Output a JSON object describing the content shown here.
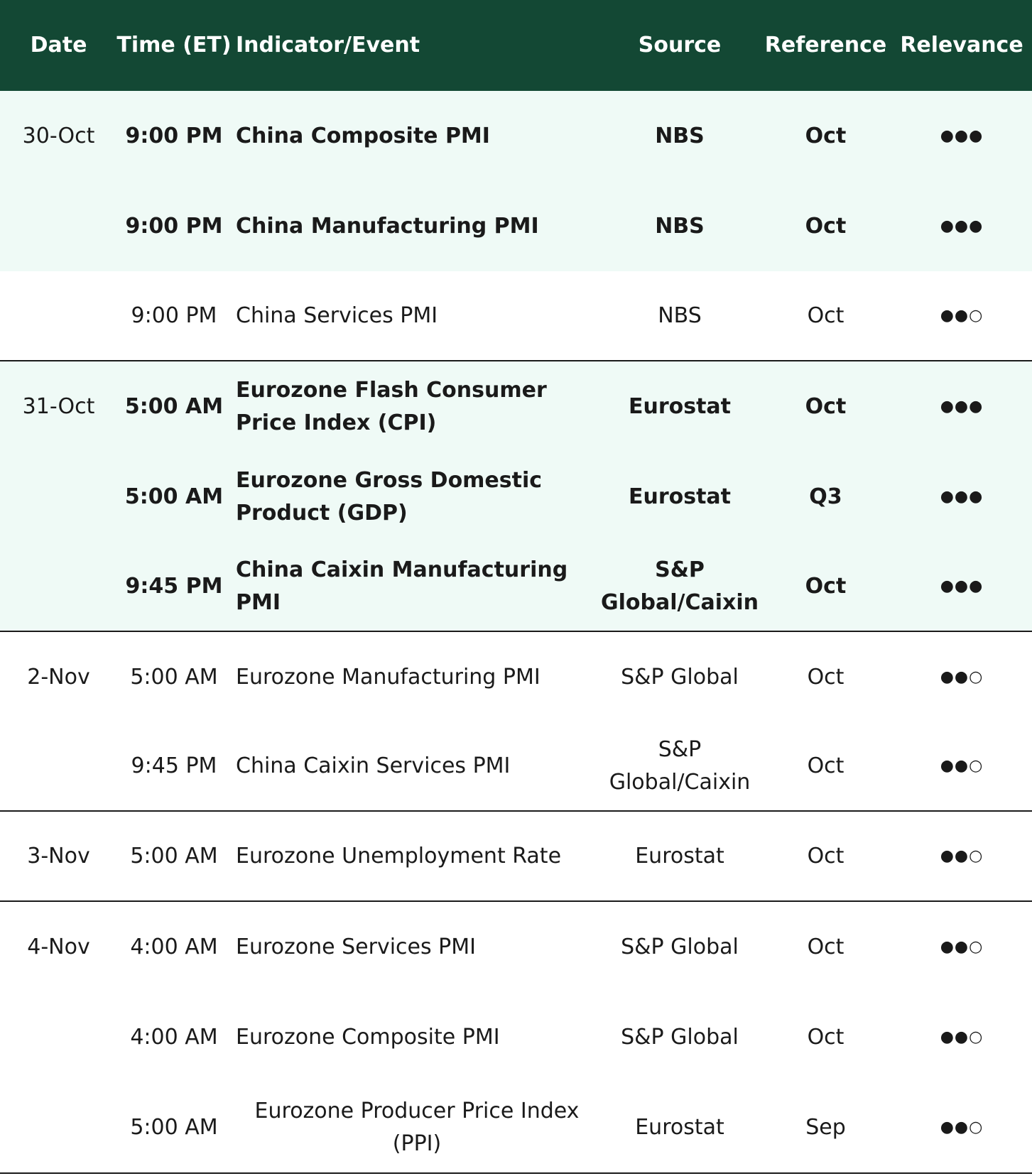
{
  "header": {
    "date": "Date",
    "time": "Time (ET)",
    "indicator": "Indicator/Event",
    "source": "Source",
    "reference": "Reference",
    "relevance": "Relevance"
  },
  "colors": {
    "header_bg": "#134834",
    "highlight_bg": "#effaf6"
  },
  "rows": [
    {
      "date": "30-Oct",
      "time": "9:00 PM",
      "indicator": "China Composite PMI",
      "source": "NBS",
      "reference": "Oct",
      "relevance": "●●●"
    },
    {
      "date": "",
      "time": "9:00 PM",
      "indicator": "China Manufacturing PMI",
      "source": "NBS",
      "reference": "Oct",
      "relevance": "●●●"
    },
    {
      "date": "",
      "time": "9:00 PM",
      "indicator": "China Services PMI",
      "source": "NBS",
      "reference": "Oct",
      "relevance": "●●○"
    },
    {
      "date": "31-Oct",
      "time": "5:00 AM",
      "indicator": "Eurozone Flash Consumer Price Index (CPI)",
      "source": "Eurostat",
      "reference": "Oct",
      "relevance": "●●●"
    },
    {
      "date": "",
      "time": "5:00 AM",
      "indicator": "Eurozone Gross Domestic Product (GDP)",
      "source": "Eurostat",
      "reference": "Q3",
      "relevance": "●●●"
    },
    {
      "date": "",
      "time": "9:45 PM",
      "indicator": "China Caixin Manufacturing PMI",
      "source": "S&P Global/Caixin",
      "reference": "Oct",
      "relevance": "●●●"
    },
    {
      "date": "2-Nov",
      "time": "5:00 AM",
      "indicator": "Eurozone Manufacturing PMI",
      "source": "S&P Global",
      "reference": "Oct",
      "relevance": "●●○"
    },
    {
      "date": "",
      "time": "9:45 PM",
      "indicator": "China Caixin Services PMI",
      "source": "S&P Global/Caixin",
      "reference": "Oct",
      "relevance": "●●○"
    },
    {
      "date": "3-Nov",
      "time": "5:00 AM",
      "indicator": "Eurozone Unemployment Rate",
      "source": "Eurostat",
      "reference": "Oct",
      "relevance": "●●○"
    },
    {
      "date": "4-Nov",
      "time": "4:00 AM",
      "indicator": "Eurozone Services PMI",
      "source": "S&P Global",
      "reference": "Oct",
      "relevance": "●●○"
    },
    {
      "date": "",
      "time": "4:00 AM",
      "indicator": "Eurozone Composite PMI",
      "source": "S&P Global",
      "reference": "Oct",
      "relevance": "●●○"
    },
    {
      "date": "",
      "time": "5:00 AM",
      "indicator": "Eurozone Producer Price Index (PPI)",
      "source": "Eurostat",
      "reference": "Sep",
      "relevance": "●●○"
    }
  ]
}
